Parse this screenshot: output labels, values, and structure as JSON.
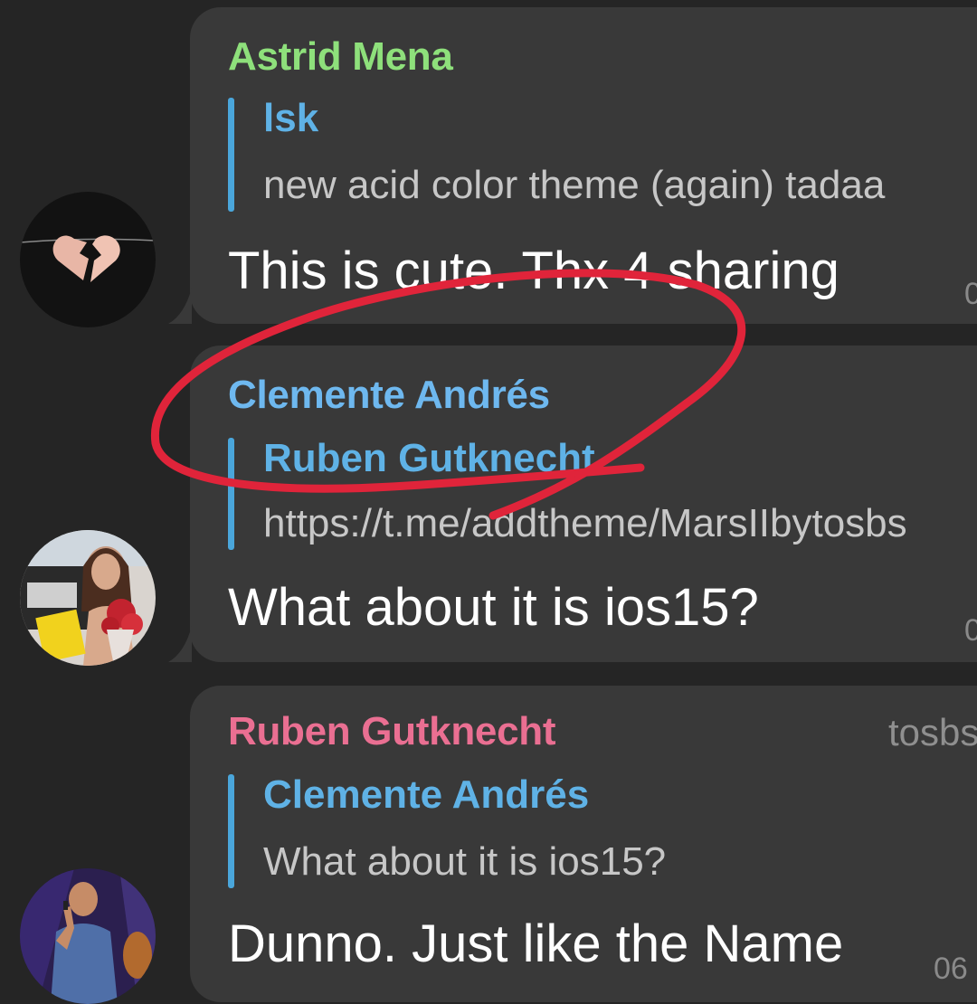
{
  "messages": [
    {
      "sender": "Astrid Mena",
      "sender_color": "#8ee07b",
      "avatar_icon": "broken-heart-avatar",
      "reply": {
        "name": "lsk",
        "text": "new acid color theme (again)   tadaa"
      },
      "text": "This is cute. Thx 4 sharing",
      "time": "0"
    },
    {
      "sender": "Clemente Andrés",
      "sender_color": "#6eb8ef",
      "avatar_icon": "person-with-flowers-avatar",
      "reply": {
        "name": "Ruben Gutknecht",
        "text": "https://t.me/addtheme/MarsIIbytosbs"
      },
      "text": "What about it is ios15?",
      "time": "0"
    },
    {
      "sender": "Ruben Gutknecht",
      "sender_color": "#ea6f92",
      "via": "tosbs",
      "avatar_icon": "speaker-on-stage-avatar",
      "reply": {
        "name": "Clemente Andrés",
        "text": "What about it is ios15?"
      },
      "text": "Dunno. Just like the Name",
      "time": "06"
    }
  ],
  "colors": {
    "background": "#252525",
    "bubble": "#393939",
    "reply_bar": "#4aa6db",
    "annotation": "#e0243a"
  }
}
